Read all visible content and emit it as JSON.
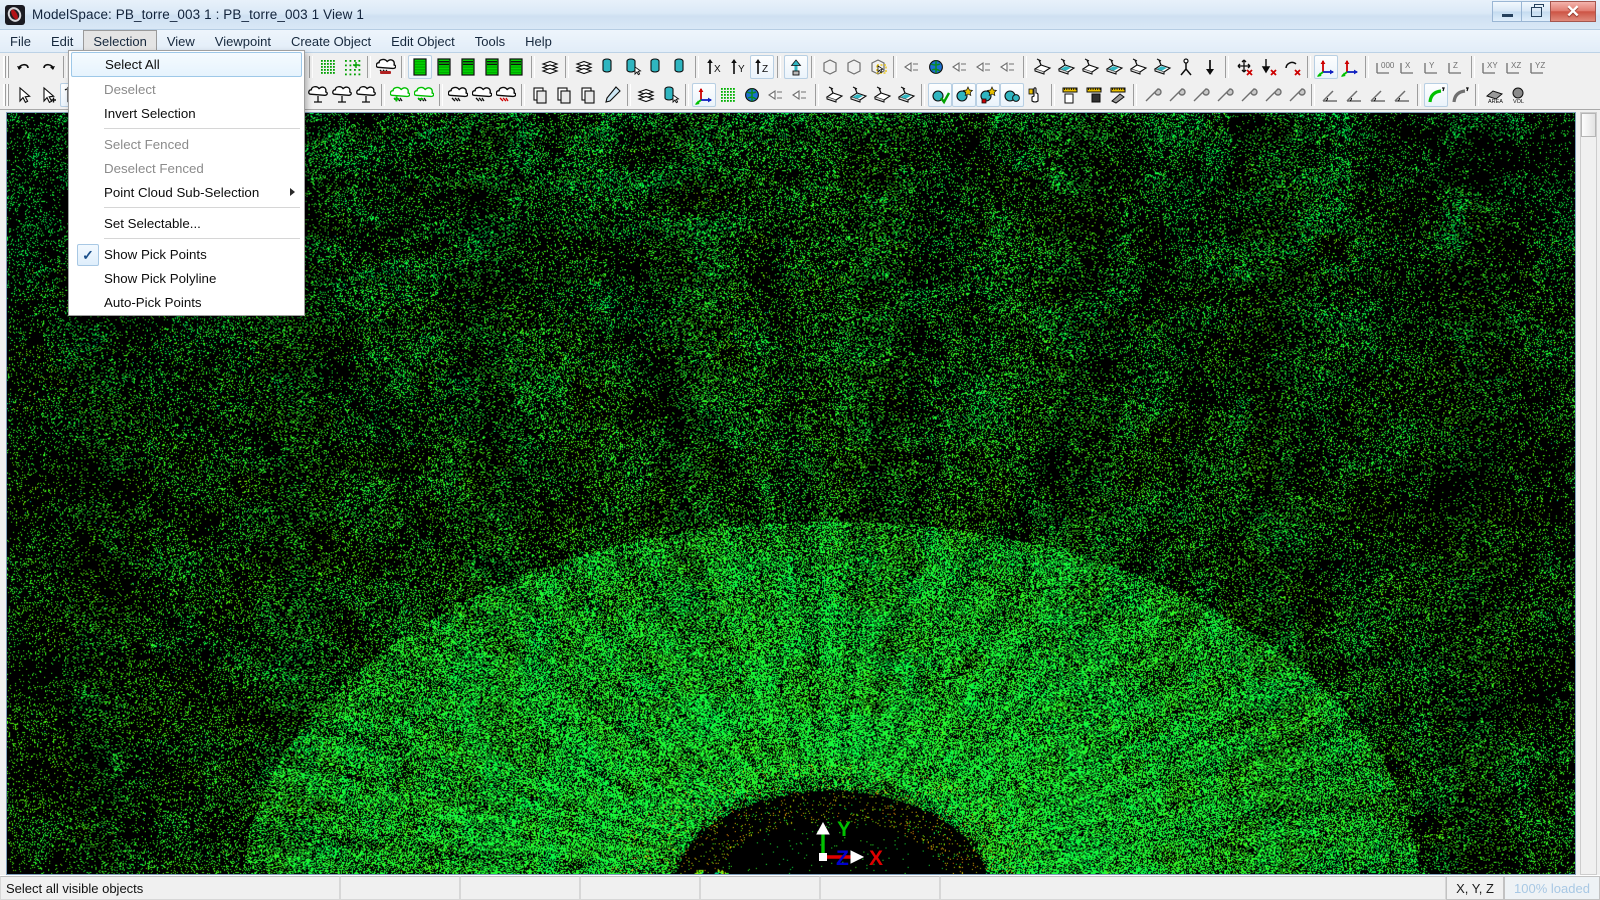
{
  "window": {
    "title": "ModelSpace: PB_torre_003 1 : PB_torre_003 1 View 1",
    "app_icon": "cyclone-logo-icon",
    "controls": {
      "minimize": "minimize-icon",
      "maximize": "restore-icon",
      "close": "✕"
    }
  },
  "menubar": {
    "items": [
      {
        "label": "File",
        "open": false
      },
      {
        "label": "Edit",
        "open": false
      },
      {
        "label": "Selection",
        "open": true
      },
      {
        "label": "View",
        "open": false
      },
      {
        "label": "Viewpoint",
        "open": false
      },
      {
        "label": "Create Object",
        "open": false
      },
      {
        "label": "Edit Object",
        "open": false
      },
      {
        "label": "Tools",
        "open": false
      },
      {
        "label": "Help",
        "open": false
      }
    ]
  },
  "selection_menu": {
    "items": [
      {
        "label": "Select All",
        "state": "highlighted",
        "check": false,
        "submenu": false
      },
      {
        "label": "Deselect",
        "state": "disabled",
        "check": false,
        "submenu": false
      },
      {
        "label": "Invert Selection",
        "state": "normal",
        "check": false,
        "submenu": false
      },
      {
        "separator": true
      },
      {
        "label": "Select Fenced",
        "state": "disabled",
        "check": false,
        "submenu": false
      },
      {
        "label": "Deselect Fenced",
        "state": "disabled",
        "check": false,
        "submenu": false
      },
      {
        "label": "Point Cloud Sub-Selection",
        "state": "normal",
        "check": false,
        "submenu": true
      },
      {
        "separator": true
      },
      {
        "label": "Set Selectable...",
        "state": "normal",
        "check": false,
        "submenu": false
      },
      {
        "separator": true
      },
      {
        "label": "Show Pick Points",
        "state": "normal",
        "check": true,
        "submenu": false
      },
      {
        "label": "Show Pick Polyline",
        "state": "normal",
        "check": false,
        "submenu": false
      },
      {
        "label": "Auto-Pick Points",
        "state": "normal",
        "check": false,
        "submenu": false
      }
    ],
    "checkmark": "✓",
    "submenu_arrow": "▶"
  },
  "toolbar_row1": [
    {
      "icon": "undo-icon",
      "active": false
    },
    {
      "icon": "redo-icon",
      "active": false
    },
    {
      "sep": true
    },
    {
      "icon": "cloud-unlimit-icon",
      "active": false
    },
    {
      "icon": "cloud-limitbox-icon",
      "active": false
    },
    {
      "icon": "cloud-fence-icon",
      "active": false
    },
    {
      "icon": "cloud-colored-icon",
      "active": false
    },
    {
      "sep": true
    },
    {
      "icon": "cloud-select-icon",
      "active": false
    },
    {
      "icon": "cloud-select-add-icon",
      "active": false
    },
    {
      "icon": "cloud-select-fence-icon",
      "active": true
    },
    {
      "icon": "cloud-deselect-icon",
      "active": false
    },
    {
      "sep": true
    },
    {
      "icon": "cloud-hilite-icon",
      "active": false
    },
    {
      "sep": true
    },
    {
      "icon": "grid-dense-icon",
      "active": false
    },
    {
      "icon": "grid-sparse-icon",
      "active": false
    },
    {
      "sep": true
    },
    {
      "icon": "cloud-car-icon",
      "active": false
    },
    {
      "sep": true
    },
    {
      "icon": "layer-green-1-icon",
      "active": true
    },
    {
      "icon": "layer-green-2-icon",
      "active": false
    },
    {
      "icon": "layer-green-3-icon",
      "active": false
    },
    {
      "icon": "layer-green-4-icon",
      "active": false
    },
    {
      "icon": "layer-green-5-icon",
      "active": false
    },
    {
      "sep": true
    },
    {
      "icon": "stack-layers-icon",
      "active": false
    },
    {
      "sep": true
    },
    {
      "icon": "stack-layers-2-icon",
      "active": false
    },
    {
      "icon": "cylinder-fit-icon",
      "active": false
    },
    {
      "icon": "cylinder-select-icon",
      "active": false
    },
    {
      "icon": "probe-cylinder-icon",
      "active": false
    },
    {
      "icon": "multi-cylinder-icon",
      "active": false
    },
    {
      "sep": true
    },
    {
      "icon": "axis-up-x-icon",
      "active": false
    },
    {
      "icon": "axis-up-y-icon",
      "active": false
    },
    {
      "icon": "axis-up-z-icon",
      "active": true
    },
    {
      "sep": true
    },
    {
      "icon": "vertical-extrude-icon",
      "active": true
    },
    {
      "sep": true
    },
    {
      "icon": "box-left-icon",
      "active": false
    },
    {
      "icon": "box-wire-icon",
      "active": false
    },
    {
      "icon": "region-pick-icon",
      "active": false
    },
    {
      "sep": true
    },
    {
      "icon": "view-cone-icon",
      "active": false
    },
    {
      "icon": "globe-view-icon",
      "active": false
    },
    {
      "icon": "reg-arrow-1-icon",
      "active": false
    },
    {
      "icon": "reg-arrow-2-icon",
      "active": false
    },
    {
      "icon": "reg-arrow-3-icon",
      "active": false
    },
    {
      "sep": true
    },
    {
      "icon": "scan-box-1-icon",
      "active": false
    },
    {
      "icon": "scan-box-2-icon",
      "active": false
    },
    {
      "icon": "scan-box-3-icon",
      "active": false
    },
    {
      "icon": "scan-box-4-icon",
      "active": false
    },
    {
      "icon": "scan-box-5-icon",
      "active": false
    },
    {
      "icon": "scan-box-6-icon",
      "active": false
    },
    {
      "icon": "scan-tripod-icon",
      "active": false
    },
    {
      "icon": "scan-down-icon",
      "active": false
    },
    {
      "sep": true
    },
    {
      "icon": "move-delete-icon",
      "active": false
    },
    {
      "icon": "drop-delete-icon",
      "active": false
    },
    {
      "icon": "rotate-delete-icon",
      "active": false
    },
    {
      "sep": true
    },
    {
      "icon": "ucs-axes-icon",
      "active": true
    },
    {
      "icon": "ucs-origin-icon",
      "active": false
    },
    {
      "sep": true
    },
    {
      "icon": "coord-000-icon",
      "active": false
    },
    {
      "icon": "coord-x-icon",
      "active": false
    },
    {
      "icon": "coord-y-icon",
      "active": false
    },
    {
      "icon": "coord-z-icon",
      "active": false
    },
    {
      "sep": true
    },
    {
      "icon": "coord-xy-icon",
      "active": false
    },
    {
      "icon": "coord-xz-icon",
      "active": false
    },
    {
      "icon": "coord-yz-icon",
      "active": false
    }
  ],
  "toolbar_row2": [
    {
      "icon": "pointer-select-icon",
      "active": false
    },
    {
      "icon": "pointer-add-icon",
      "active": false
    },
    {
      "icon": "pointer-fence-icon",
      "active": true
    },
    {
      "sep": true
    },
    {
      "icon": "zoom-window-icon",
      "active": false
    },
    {
      "icon": "zoom-in-icon",
      "active": false
    },
    {
      "icon": "pan-icon",
      "active": false
    },
    {
      "icon": "orbit-icon",
      "active": false
    },
    {
      "icon": "zoom-extents-icon",
      "active": false
    },
    {
      "sep": true
    },
    {
      "icon": "cloud-region-1-icon",
      "active": false
    },
    {
      "icon": "cloud-region-2-icon",
      "active": false
    },
    {
      "sep": true
    },
    {
      "icon": "mesh-1-icon",
      "active": false
    },
    {
      "icon": "mesh-2-icon",
      "active": false
    },
    {
      "icon": "mesh-3-icon",
      "active": false
    },
    {
      "icon": "mesh-4-icon",
      "active": false
    },
    {
      "sep": true
    },
    {
      "icon": "cloud-add-green-icon",
      "active": false
    },
    {
      "icon": "cloud-sub-green-icon",
      "active": false
    },
    {
      "sep": true
    },
    {
      "icon": "cloud-cut-icon",
      "active": false
    },
    {
      "icon": "cloud-trim-icon",
      "active": false
    },
    {
      "icon": "cloud-red-line-icon",
      "active": false
    },
    {
      "sep": true
    },
    {
      "icon": "copy-1-icon",
      "active": false
    },
    {
      "icon": "paste-icon",
      "active": false
    },
    {
      "icon": "duplicate-icon",
      "active": false
    },
    {
      "icon": "probe-pen-icon",
      "active": false
    },
    {
      "sep": true
    },
    {
      "icon": "stack-layers-b-icon",
      "active": false
    },
    {
      "icon": "cylinder-pick-icon",
      "active": false
    },
    {
      "sep": true
    },
    {
      "icon": "ucs-move-icon",
      "active": true
    },
    {
      "icon": "grid-green-icon",
      "active": false
    },
    {
      "icon": "globe-green-icon",
      "active": false
    },
    {
      "icon": "reg-ghost-1-icon",
      "active": false
    },
    {
      "icon": "reg-ghost-2-icon",
      "active": false
    },
    {
      "sep": true
    },
    {
      "icon": "scan-view-1-icon",
      "active": false
    },
    {
      "icon": "scan-view-2-icon",
      "active": false
    },
    {
      "icon": "scan-view-3-icon",
      "active": false
    },
    {
      "icon": "scan-view-4-icon",
      "active": false
    },
    {
      "sep": true
    },
    {
      "icon": "validate-check-icon",
      "active": true
    },
    {
      "icon": "validate-star-icon",
      "active": true
    },
    {
      "icon": "lock-red-icon",
      "active": true
    },
    {
      "icon": "binocular-icon",
      "active": true
    },
    {
      "icon": "hand-point-icon",
      "active": false
    },
    {
      "sep": true
    },
    {
      "icon": "ruler-build-icon",
      "active": false
    },
    {
      "icon": "ruler-save-icon",
      "active": false
    },
    {
      "icon": "ruler-gray-icon",
      "active": false
    },
    {
      "sep": true
    },
    {
      "icon": "tool-wrench-1-icon",
      "active": false
    },
    {
      "icon": "tool-wrench-2-icon",
      "active": false
    },
    {
      "icon": "tool-wrench-3-icon",
      "active": false
    },
    {
      "icon": "tool-wrench-4-icon",
      "active": false
    },
    {
      "icon": "tool-wrench-5-icon",
      "active": false
    },
    {
      "icon": "tool-box-d-icon",
      "active": false
    },
    {
      "icon": "tool-box-e-icon",
      "active": false
    },
    {
      "sep": true
    },
    {
      "icon": "angle-measure-icon",
      "active": false
    },
    {
      "icon": "radius-measure-icon",
      "active": false
    },
    {
      "icon": "slope-measure-icon",
      "active": false
    },
    {
      "icon": "angle-theta-icon",
      "active": false
    },
    {
      "sep": true
    },
    {
      "icon": "pipe-green-icon",
      "active": true
    },
    {
      "icon": "pipe-gray-icon",
      "active": false
    },
    {
      "sep": true
    },
    {
      "icon": "area-measure-icon",
      "active": false
    },
    {
      "icon": "volume-measure-icon",
      "active": false
    }
  ],
  "measure_labels": {
    "area": "AREA",
    "volume": "VOL"
  },
  "viewport": {
    "background": "#000000",
    "gizmo": {
      "x_label": "X",
      "y_label": "Y",
      "z_label": "Z",
      "x_color": "#dd0000",
      "y_color": "#00c000",
      "z_color": "#0000cc"
    },
    "point_colors": {
      "dominant": "#00e878",
      "cyan": "#30e8c8",
      "green": "#00ff44",
      "yellow": "#e8e800",
      "orange": "#ff8800",
      "red": "#ee2200"
    }
  },
  "statusbar": {
    "message": "Select all visible objects",
    "coordinates_label": "X, Y, Z",
    "load_status": "100% loaded"
  }
}
